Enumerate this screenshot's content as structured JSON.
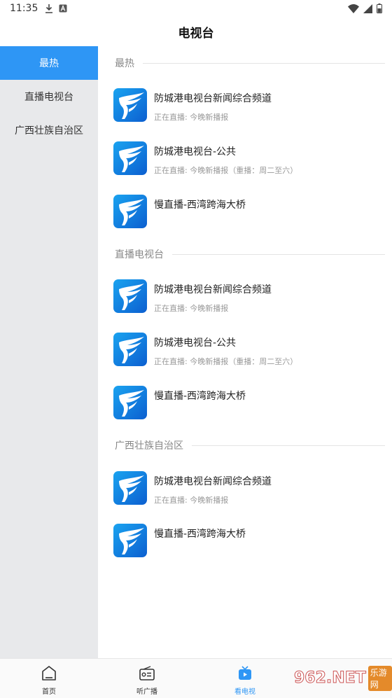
{
  "status_bar": {
    "time": "11:35",
    "icons": [
      "download-icon",
      "a-icon",
      "wifi-icon",
      "signal-icon",
      "battery-icon"
    ]
  },
  "header": {
    "title": "电视台"
  },
  "sidebar": {
    "items": [
      {
        "label": "最热",
        "active": true
      },
      {
        "label": "直播电视台",
        "active": false
      },
      {
        "label": "广西壮族自治区",
        "active": false
      }
    ]
  },
  "sections": [
    {
      "title": "最热",
      "items": [
        {
          "name": "防城港电视台新闻综合频道",
          "status": "正在直播:  今晚新播报"
        },
        {
          "name": "防城港电视台-公共",
          "status": "正在直播:  今晚新播报（重播：周二至六）"
        },
        {
          "name": "慢直播-西湾跨海大桥",
          "status": ""
        }
      ]
    },
    {
      "title": "直播电视台",
      "items": [
        {
          "name": "防城港电视台新闻综合频道",
          "status": "正在直播:  今晚新播报"
        },
        {
          "name": "防城港电视台-公共",
          "status": "正在直播:  今晚新播报（重播：周二至六）"
        },
        {
          "name": "慢直播-西湾跨海大桥",
          "status": ""
        }
      ]
    },
    {
      "title": "广西壮族自治区",
      "items": [
        {
          "name": "防城港电视台新闻综合频道",
          "status": "正在直播:  今晚新播报"
        },
        {
          "name": "慢直播-西湾跨海大桥",
          "status": ""
        }
      ]
    }
  ],
  "bottom_nav": {
    "items": [
      {
        "label": "首页",
        "icon": "home-icon",
        "active": false
      },
      {
        "label": "听广播",
        "icon": "radio-icon",
        "active": false
      },
      {
        "label": "看电视",
        "icon": "tv-icon",
        "active": true
      }
    ]
  },
  "watermark": {
    "text": "962.NET",
    "sub": "乐游网"
  },
  "colors": {
    "accent": "#2e96f5",
    "sidebar_bg": "#e8e9eb"
  }
}
